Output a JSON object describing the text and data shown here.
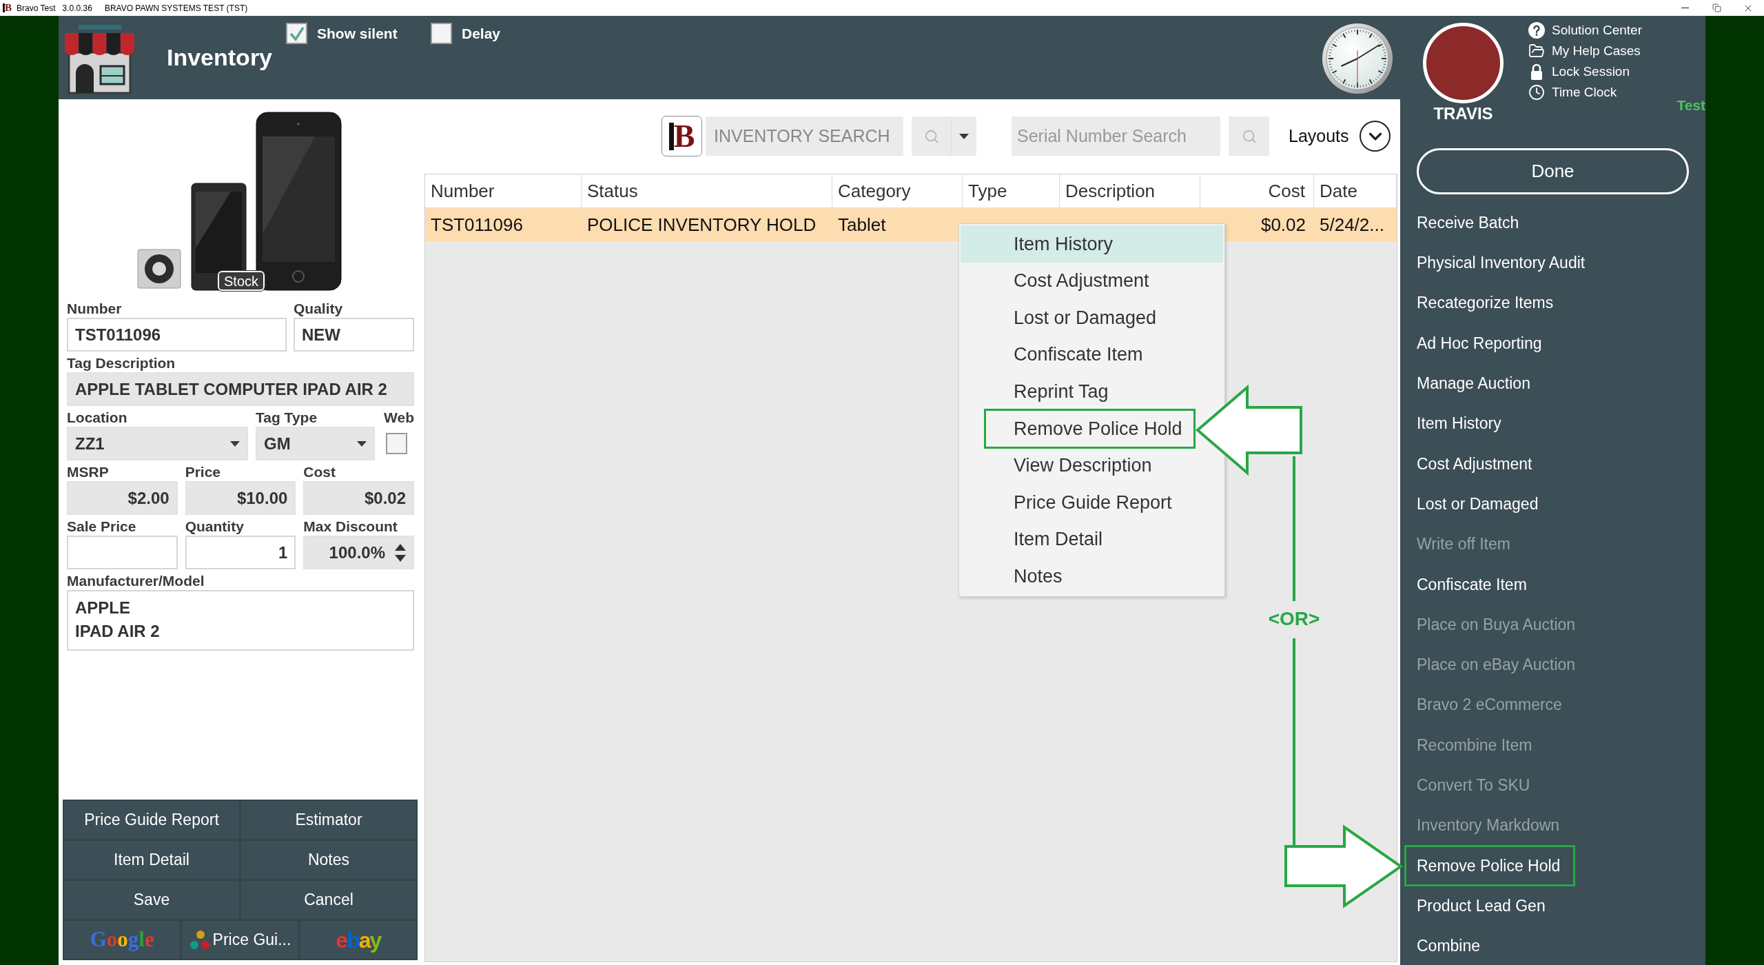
{
  "title_bar": {
    "logo": "B",
    "app": "Bravo Test",
    "version": "3.0.0.36",
    "system": "BRAVO PAWN SYSTEMS TEST (TST)"
  },
  "header": {
    "title": "Inventory",
    "options": [
      {
        "label": "Show silent",
        "checked": true
      },
      {
        "label": "Delay",
        "checked": false
      }
    ]
  },
  "user": {
    "name": "TRAVIS",
    "links": [
      {
        "kind": "help",
        "label": "Solution Center"
      },
      {
        "kind": "folder",
        "label": "My Help Cases"
      },
      {
        "kind": "lock",
        "label": "Lock Session"
      },
      {
        "kind": "clock",
        "label": "Time Clock"
      }
    ],
    "environment": "Test"
  },
  "item": {
    "image_badge": "Stock",
    "number": {
      "label": "Number",
      "value": "TST011096",
      "readonly": false
    },
    "quality": {
      "label": "Quality",
      "value": "NEW",
      "readonly": false
    },
    "tag_description": {
      "label": "Tag Description",
      "value": "APPLE TABLET COMPUTER IPAD AIR 2",
      "readonly": true
    },
    "location": {
      "label": "Location",
      "value": "ZZ1"
    },
    "tag_type": {
      "label": "Tag Type",
      "value": "GM"
    },
    "web": {
      "label": "Web",
      "checked": false
    },
    "msrp": {
      "label": "MSRP",
      "value": "$2.00",
      "readonly": true
    },
    "price": {
      "label": "Price",
      "value": "$10.00",
      "readonly": true
    },
    "cost": {
      "label": "Cost",
      "value": "$0.02",
      "readonly": true
    },
    "sale_price": {
      "label": "Sale Price",
      "readonly": false
    },
    "quantity": {
      "label": "Quantity",
      "value": "1",
      "readonly": false
    },
    "max_discount": {
      "label": "Max Discount",
      "value": "100.0%"
    },
    "manufacturer_model": {
      "label": "Manufacturer/Model",
      "lines": [
        "APPLE",
        "IPAD AIR 2"
      ]
    }
  },
  "actions": [
    "Price Guide Report",
    "Estimator",
    "Item Detail",
    "Notes",
    "Save",
    "Cancel"
  ],
  "lookups": [
    {
      "kind": "google",
      "label": "Google"
    },
    {
      "kind": "price_guide",
      "label": "Price Gui..."
    },
    {
      "kind": "ebay",
      "label": "ebay"
    }
  ],
  "search": {
    "logo": "B",
    "inventory": {
      "placeholder": "INVENTORY SEARCH"
    },
    "serial": {
      "placeholder": "Serial Number Search"
    },
    "layouts": "Layouts"
  },
  "table": {
    "columns": [
      {
        "label": "Number",
        "kind": "text"
      },
      {
        "label": "Status",
        "kind": "text"
      },
      {
        "label": "Category",
        "kind": "text"
      },
      {
        "label": "Type",
        "kind": "text"
      },
      {
        "label": "Description",
        "kind": "text"
      },
      {
        "label": "Cost",
        "kind": "amount"
      },
      {
        "label": "Date",
        "kind": "text"
      }
    ],
    "rows": [
      {
        "selected": true,
        "cells": [
          "TST011096",
          "POLICE INVENTORY HOLD",
          "Tablet",
          null,
          null,
          "$0.02",
          "5/24/2..."
        ]
      }
    ]
  },
  "context_menu": {
    "items": [
      {
        "label": "Item History",
        "hovered": true,
        "highlighted": false
      },
      {
        "label": "Cost Adjustment",
        "hovered": false,
        "highlighted": false
      },
      {
        "label": "Lost or Damaged",
        "hovered": false,
        "highlighted": false
      },
      {
        "label": "Confiscate Item",
        "hovered": false,
        "highlighted": false
      },
      {
        "label": "Reprint Tag",
        "hovered": false,
        "highlighted": false
      },
      {
        "label": "Remove Police Hold",
        "hovered": false,
        "highlighted": true
      },
      {
        "label": "View Description",
        "hovered": false,
        "highlighted": false
      },
      {
        "label": "Price Guide Report",
        "hovered": false,
        "highlighted": false
      },
      {
        "label": "Item Detail",
        "hovered": false,
        "highlighted": false
      },
      {
        "label": "Notes",
        "hovered": false,
        "highlighted": false
      }
    ]
  },
  "sidebar": {
    "done": "Done",
    "items": [
      {
        "label": "Receive Batch",
        "disabled": false,
        "highlighted": false
      },
      {
        "label": "Physical Inventory Audit",
        "disabled": false,
        "highlighted": false
      },
      {
        "label": "Recategorize Items",
        "disabled": false,
        "highlighted": false
      },
      {
        "label": "Ad Hoc Reporting",
        "disabled": false,
        "highlighted": false
      },
      {
        "label": "Manage Auction",
        "disabled": false,
        "highlighted": false
      },
      {
        "label": "Item History",
        "disabled": false,
        "highlighted": false
      },
      {
        "label": "Cost Adjustment",
        "disabled": false,
        "highlighted": false
      },
      {
        "label": "Lost or Damaged",
        "disabled": false,
        "highlighted": false
      },
      {
        "label": "Write off Item",
        "disabled": true,
        "highlighted": false
      },
      {
        "label": "Confiscate Item",
        "disabled": false,
        "highlighted": false
      },
      {
        "label": "Place on Buya Auction",
        "disabled": true,
        "highlighted": false
      },
      {
        "label": "Place on eBay Auction",
        "disabled": true,
        "highlighted": false
      },
      {
        "label": "Bravo 2 eCommerce",
        "disabled": true,
        "highlighted": false
      },
      {
        "label": "Recombine Item",
        "disabled": true,
        "highlighted": false
      },
      {
        "label": "Convert To SKU",
        "disabled": true,
        "highlighted": false
      },
      {
        "label": "Inventory Markdown",
        "disabled": true,
        "highlighted": false
      },
      {
        "label": "Remove Police Hold",
        "disabled": false,
        "highlighted": true
      },
      {
        "label": "Product Lead Gen",
        "disabled": false,
        "highlighted": false
      },
      {
        "label": "Combine",
        "disabled": false,
        "highlighted": false
      }
    ]
  },
  "annotation": {
    "label": "<OR>"
  }
}
